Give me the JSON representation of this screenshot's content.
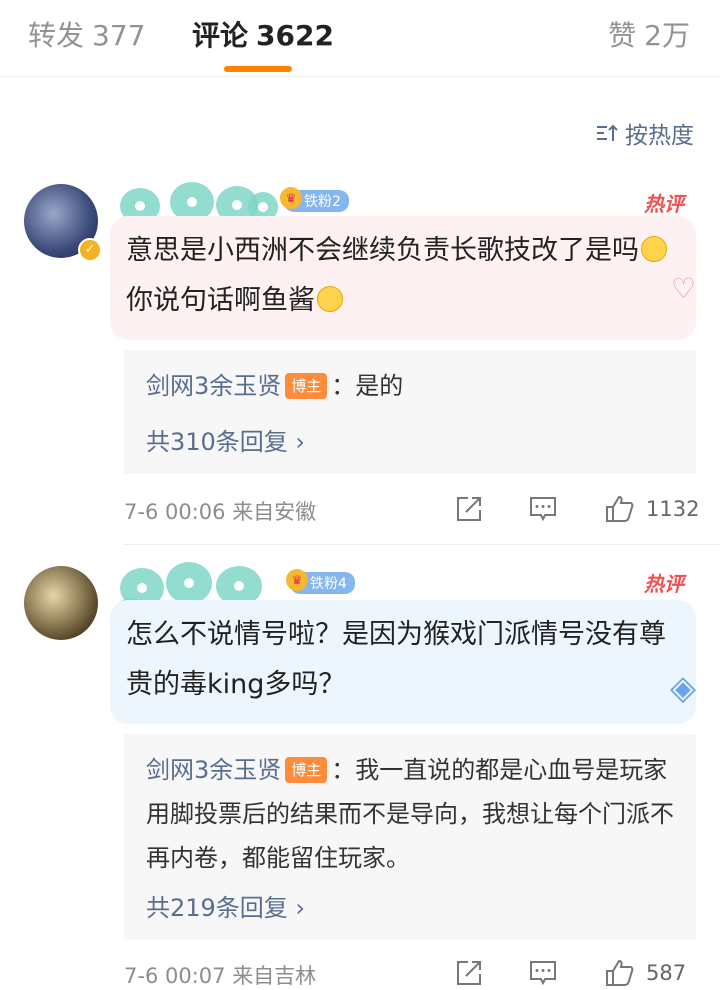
{
  "tabs": {
    "repost": {
      "label": "转发",
      "count": "377"
    },
    "comment": {
      "label": "评论",
      "count": "3622"
    },
    "like": {
      "label": "赞",
      "count": "2万"
    }
  },
  "sort": {
    "label": "按热度"
  },
  "comments": [
    {
      "fan_badge": "铁粉2",
      "hot_label": "热评",
      "text_part1": "意思是小西洲不会继续负责长歌技改了是吗",
      "text_part2": "你说句话啊鱼酱",
      "reply": {
        "author": "剑网3余玉贤",
        "badge": "博主",
        "text": "：是的",
        "more": "共310条回复 ›"
      },
      "time": "7-6 00:06",
      "location": "来自安徽",
      "likes": "1132"
    },
    {
      "fan_badge": "铁粉4",
      "hot_label": "热评",
      "text": "怎么不说情号啦？是因为猴戏门派情号没有尊贵的毒king多吗？",
      "reply": {
        "author": "剑网3余玉贤",
        "badge": "博主",
        "text": "：我一直说的都是心血号是玩家用脚投票后的结果而不是导向，我想让每个门派不再内卷，都能留住玩家。",
        "more": "共219条回复 ›"
      },
      "time": "7-6 00:07",
      "location": "来自吉林",
      "likes": "587"
    }
  ],
  "colors": {
    "accent": "#ff8200",
    "link": "#596e8e",
    "hot": "#f05252"
  }
}
